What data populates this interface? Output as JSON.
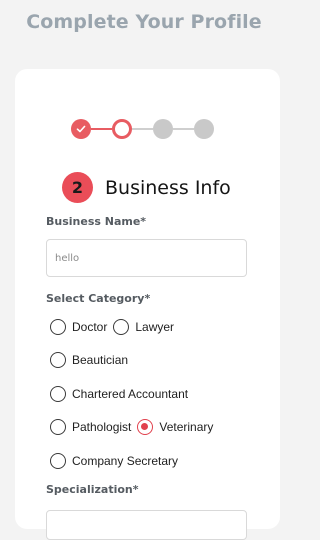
{
  "header": {
    "title": "Complete Your Profile"
  },
  "section": {
    "number": "2",
    "title": "Business Info"
  },
  "business_name": {
    "label": "Business Name*",
    "value": "hello"
  },
  "category": {
    "label": "Select Category*",
    "options": [
      {
        "label": "Doctor",
        "checked": false
      },
      {
        "label": "Lawyer",
        "checked": false
      },
      {
        "label": "Beautician",
        "checked": false
      },
      {
        "label": "Chartered Accountant",
        "checked": false
      },
      {
        "label": "Pathologist",
        "checked": false
      },
      {
        "label": "Veterinary",
        "checked": true
      },
      {
        "label": "Company Secretary",
        "checked": false
      }
    ]
  },
  "specialization": {
    "label": "Specialization*"
  },
  "colors": {
    "accent": "#e85c62",
    "title": "#9aa5ae",
    "inactive_step": "#c9c9c9"
  }
}
